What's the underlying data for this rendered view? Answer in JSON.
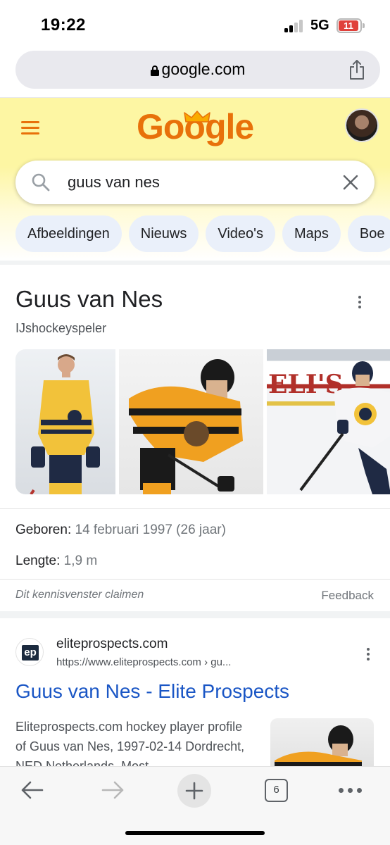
{
  "status_bar": {
    "time": "19:22",
    "network": "5G",
    "battery": "11"
  },
  "browser": {
    "url": "google.com"
  },
  "google": {
    "logo": "Google"
  },
  "search": {
    "query": "guus van nes"
  },
  "chips": [
    "Afbeeldingen",
    "Nieuws",
    "Video's",
    "Maps",
    "Boe"
  ],
  "knowledge_panel": {
    "title": "Guus van Nes",
    "subtitle": "IJshockeyspeler",
    "facts": {
      "born_label": "Geboren:",
      "born_value": " 14 februari 1997 (26 jaar)",
      "length_label": "Lengte:",
      "length_value": " 1,9 m"
    },
    "claim": "Dit kennisvenster claimen",
    "feedback": "Feedback"
  },
  "result": {
    "favicon_text": "ep",
    "site": "eliteprospects.com",
    "url": "https://www.eliteprospects.com › gu...",
    "title": "Guus van Nes - Elite Prospects",
    "snippet": "Eliteprospects.com hockey player profile of Guus van Nes, 1997-02-14 Dordrecht, NED Netherlands. Most"
  },
  "toolbar": {
    "tab_count": "6"
  },
  "colors": {
    "accent": "#e8710a",
    "link": "#1a56c5",
    "header_bg": "#fdf6a3",
    "chip_bg": "#eaf0fa"
  }
}
